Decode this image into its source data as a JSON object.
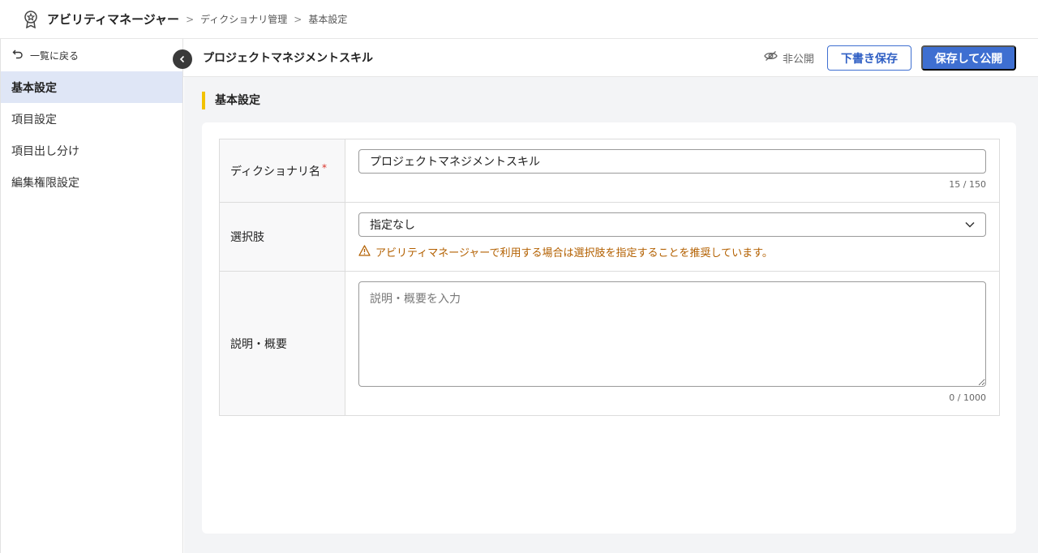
{
  "app": {
    "name": "アビリティマネージャー"
  },
  "breadcrumb": [
    "ディクショナリ管理",
    "基本設定"
  ],
  "sidebar": {
    "back_label": "一覧に戻る",
    "items": [
      {
        "label": "基本設定",
        "active": true
      },
      {
        "label": "項目設定"
      },
      {
        "label": "項目出し分け"
      },
      {
        "label": "編集権限設定"
      }
    ]
  },
  "header": {
    "title": "プロジェクトマネジメントスキル",
    "status": "非公開",
    "draft_label": "下書き保存",
    "publish_label": "保存して公開"
  },
  "section": {
    "title": "基本設定"
  },
  "form": {
    "name": {
      "label": "ディクショナリ名",
      "required_mark": "*",
      "value": "プロジェクトマネジメントスキル",
      "counter": "15 / 150"
    },
    "choices": {
      "label": "選択肢",
      "selected": "指定なし",
      "warning": "アビリティマネージャーで利用する場合は選択肢を指定することを推奨しています。"
    },
    "description": {
      "label": "説明・概要",
      "placeholder": "説明・概要を入力",
      "value": "",
      "counter": "0 / 1000"
    }
  },
  "colors": {
    "primary": "#3e6fd1",
    "warning": "#b36000",
    "accent_bar": "#f2c200",
    "active_bg": "#dfe6f6"
  }
}
